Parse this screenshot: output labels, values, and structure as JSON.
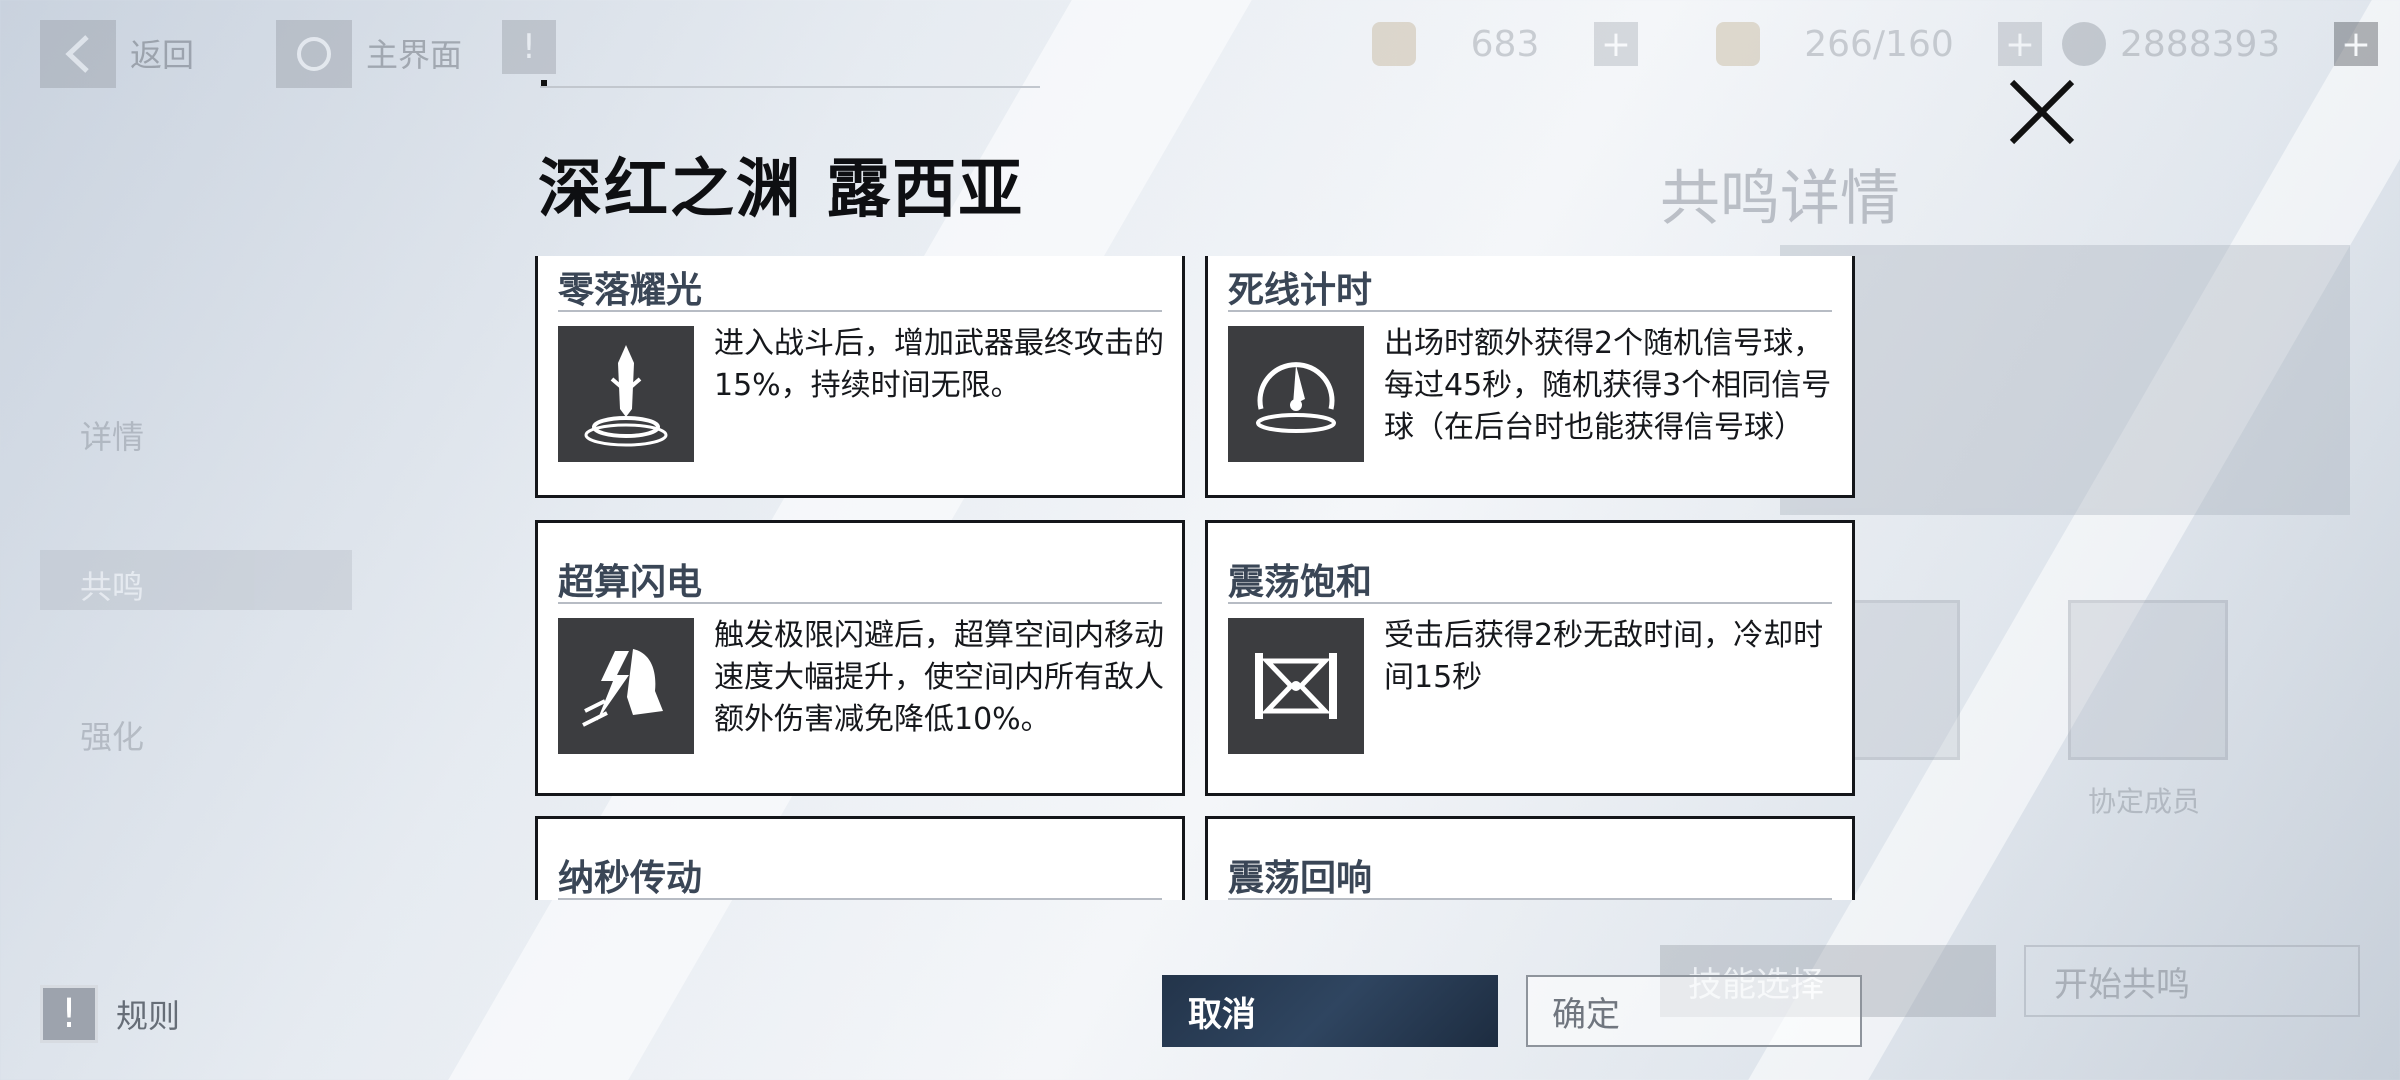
{
  "topbar": {
    "back_label": "返回",
    "main_label": "主界面",
    "resources": [
      {
        "value": "683",
        "icon": "fuel-icon"
      },
      {
        "value": "266/160",
        "icon": "stamina-icon"
      },
      {
        "value": "2888393",
        "icon": "coin-icon"
      }
    ]
  },
  "side_menu": [
    "详情",
    "共鸣",
    "强化"
  ],
  "background": {
    "title": "共鸣详情",
    "buttons": [
      "技能选择",
      "开始共鸣"
    ],
    "card_labels": [
      "",
      "协定成员"
    ]
  },
  "rules_label": "规则",
  "modal": {
    "title": "深红之渊 露西亚",
    "skills": [
      {
        "name": "零落耀光",
        "icon": "sword-icon",
        "desc": "进入战斗后，增加武器最终攻击的15%，持续时间无限。"
      },
      {
        "name": "死线计时",
        "icon": "signal-orb-icon",
        "desc": "出场时额外获得2个随机信号球，每过45秒，随机获得3个相同信号球（在后台时也能获得信号球）"
      },
      {
        "name": "超算闪电",
        "icon": "lightning-boot-icon",
        "desc": "触发极限闪避后，超算空间内移动速度大幅提升，使空间内所有敌人额外伤害减免降低10%。"
      },
      {
        "name": "震荡饱和",
        "icon": "hourglass-icon",
        "desc": "受击后获得2秒无敌时间，冷却时间15秒"
      },
      {
        "name": "纳秒传动",
        "icon": "",
        "desc": ""
      },
      {
        "name": "震荡回响",
        "icon": "",
        "desc": ""
      }
    ],
    "cancel_label": "取消",
    "confirm_label": "确定"
  }
}
